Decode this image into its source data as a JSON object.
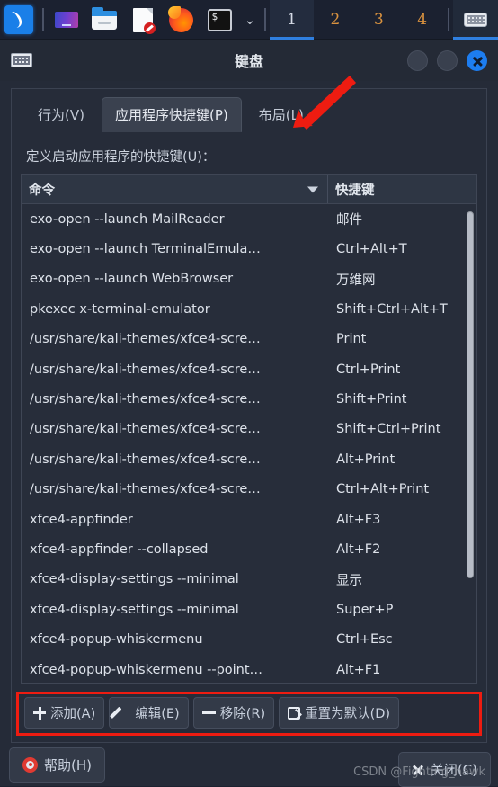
{
  "taskbar": {
    "launcher": {
      "name": "kali-menu",
      "icon": "kali-dragon-icon"
    },
    "apps": [
      {
        "name": "show-desktop",
        "icon": "desktop-icon"
      },
      {
        "name": "file-manager",
        "icon": "folder-icon"
      },
      {
        "name": "text-editor",
        "icon": "document-icon"
      },
      {
        "name": "firefox",
        "icon": "firefox-icon"
      },
      {
        "name": "terminal",
        "icon": "terminal-icon"
      }
    ],
    "dropdown_glyph": "⌄",
    "workspaces": [
      {
        "label": "1",
        "active": true
      },
      {
        "label": "2",
        "active": false
      },
      {
        "label": "3",
        "active": false
      },
      {
        "label": "4",
        "active": false
      }
    ],
    "tray": {
      "name": "keyboard-layout-indicator",
      "icon": "keyboard-icon"
    }
  },
  "window": {
    "icon": "keyboard-icon",
    "title": "键盘",
    "controls": {
      "minimize": "",
      "maximize": "",
      "close": "✕"
    }
  },
  "tabs": [
    {
      "label": "行为(V)",
      "active": false
    },
    {
      "label": "应用程序快捷键(P)",
      "active": true
    },
    {
      "label": "布局(L)",
      "active": false
    }
  ],
  "panel": {
    "section_label": "定义启动应用程序的快捷键(U)：",
    "table": {
      "columns": [
        {
          "label": "命令",
          "sort": "descending"
        },
        {
          "label": "快捷键",
          "sort": "none"
        }
      ],
      "rows": [
        {
          "command": "exo-open --launch MailReader",
          "shortcut": "邮件"
        },
        {
          "command": "exo-open --launch TerminalEmula…",
          "shortcut": "Ctrl+Alt+T"
        },
        {
          "command": "exo-open --launch WebBrowser",
          "shortcut": "万维网"
        },
        {
          "command": "pkexec x-terminal-emulator",
          "shortcut": "Shift+Ctrl+Alt+T"
        },
        {
          "command": "/usr/share/kali-themes/xfce4-scre…",
          "shortcut": "Print"
        },
        {
          "command": "/usr/share/kali-themes/xfce4-scre…",
          "shortcut": "Ctrl+Print"
        },
        {
          "command": "/usr/share/kali-themes/xfce4-scre…",
          "shortcut": "Shift+Print"
        },
        {
          "command": "/usr/share/kali-themes/xfce4-scre…",
          "shortcut": "Shift+Ctrl+Print"
        },
        {
          "command": "/usr/share/kali-themes/xfce4-scre…",
          "shortcut": "Alt+Print"
        },
        {
          "command": "/usr/share/kali-themes/xfce4-scre…",
          "shortcut": "Ctrl+Alt+Print"
        },
        {
          "command": "xfce4-appfinder",
          "shortcut": "Alt+F3"
        },
        {
          "command": "xfce4-appfinder --collapsed",
          "shortcut": "Alt+F2"
        },
        {
          "command": "xfce4-display-settings --minimal",
          "shortcut": "显示"
        },
        {
          "command": "xfce4-display-settings --minimal",
          "shortcut": "Super+P"
        },
        {
          "command": "xfce4-popup-whiskermenu",
          "shortcut": "Ctrl+Esc"
        },
        {
          "command": "xfce4-popup-whiskermenu --point…",
          "shortcut": "Alt+F1"
        }
      ]
    }
  },
  "actions": [
    {
      "label": "添加(A)",
      "icon": "plus-icon"
    },
    {
      "label": "编辑(E)",
      "icon": "pencil-icon"
    },
    {
      "label": "移除(R)",
      "icon": "minus-icon"
    },
    {
      "label": "重置为默认(D)",
      "icon": "reset-icon"
    }
  ],
  "footer": {
    "help_label": "帮助(H)",
    "help_icon": "lifebuoy-icon",
    "close_label": "关闭(C)",
    "close_icon": "x-icon"
  },
  "watermark": "CSDN @Fighting_hawk",
  "annotations": {
    "arrow": {
      "name": "red-arrow-pointing-to-active-tab",
      "color": "#ee1c11"
    },
    "box": {
      "name": "red-box-around-action-buttons",
      "color": "#ee1c11"
    }
  },
  "colors": {
    "accent": "#1d7df0",
    "annotation": "#ee1c11",
    "window_bg": "#252b38",
    "panel_bg": "#262c39",
    "taskbar_bg": "#1b2130",
    "workspace_number": "#d9923f"
  }
}
